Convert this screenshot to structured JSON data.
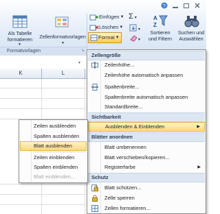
{
  "ribbon": {
    "table_label": "Als Tabelle formatieren",
    "table_label_1": "Als Tabelle",
    "table_label_2": "formatieren",
    "cellstyles_label": "Zellenformatvorlagen",
    "group_label": "Formatvorlagen",
    "insert_label": "Einfügen",
    "delete_label": "Löschen",
    "format_label": "Format",
    "sort_label_1": "Sortieren",
    "sort_label_2": "und Filtern",
    "find_label_1": "Suchen und",
    "find_label_2": "Auswählen",
    "sigma": "Σ"
  },
  "sheet": {
    "columns": [
      "K",
      "L"
    ]
  },
  "format_menu": {
    "sections": {
      "size": "Zellengröße",
      "visibility": "Sichtbarkeit",
      "arrange": "Blätter anordnen",
      "protect": "Schutz"
    },
    "items": {
      "row_height": "Zeilenhöhe...",
      "row_autofit": "Zeilenhöhe automatisch anpassen",
      "col_width": "Spaltenbreite...",
      "col_autofit": "Spaltenbreite automatisch anpassen",
      "default_width": "Standardbreite...",
      "hide_show": "Ausblenden & Einblenden",
      "rename_sheet": "Blatt umbenennen",
      "move_copy": "Blatt verschieben/kopieren...",
      "tab_color": "Registerfarbe",
      "protect_sheet": "Blatt schützen...",
      "lock_cell": "Zelle sperren",
      "format_cells": "Zellen formatieren..."
    }
  },
  "submenu": {
    "items": [
      {
        "label": "Zeilen ausblenden",
        "disabled": false
      },
      {
        "label": "Spalten ausblenden",
        "disabled": false
      },
      {
        "label": "Blatt ausblenden",
        "disabled": false,
        "highlighted": true
      },
      {
        "label": "Zeilen einblenden",
        "disabled": false
      },
      {
        "label": "Spalten einblenden",
        "disabled": false
      },
      {
        "label": "Blatt einblenden...",
        "disabled": true
      }
    ]
  },
  "window": {
    "icons": [
      "minimize-icon",
      "restore-icon",
      "close-icon"
    ]
  }
}
